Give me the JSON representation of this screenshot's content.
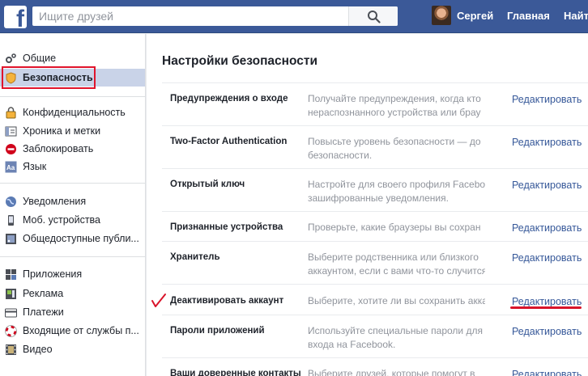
{
  "header": {
    "search_placeholder": "Ищите друзей",
    "user_name": "Сергей",
    "nav_home": "Главная",
    "nav_find": "Найти"
  },
  "sidebar": {
    "items": [
      {
        "label": "Общие",
        "icon": "gear-icon"
      },
      {
        "label": "Безопасность",
        "icon": "shield-icon",
        "active": true
      },
      {
        "label": "Конфиденциальность",
        "icon": "lock-icon"
      },
      {
        "label": "Хроника и метки",
        "icon": "timeline-icon"
      },
      {
        "label": "Заблокировать",
        "icon": "block-icon"
      },
      {
        "label": "Язык",
        "icon": "language-icon"
      },
      {
        "label": "Уведомления",
        "icon": "globe-icon"
      },
      {
        "label": "Моб. устройства",
        "icon": "mobile-icon"
      },
      {
        "label": "Общедоступные публи...",
        "icon": "rss-icon"
      },
      {
        "label": "Приложения",
        "icon": "apps-icon"
      },
      {
        "label": "Реклама",
        "icon": "ads-icon"
      },
      {
        "label": "Платежи",
        "icon": "card-icon"
      },
      {
        "label": "Входящие от службы п...",
        "icon": "lifebuoy-icon"
      },
      {
        "label": "Видео",
        "icon": "film-icon"
      }
    ]
  },
  "main": {
    "title": "Настройки безопасности",
    "edit_label": "Редактировать",
    "rows": [
      {
        "label": "Предупреждения о входе",
        "desc": [
          "Получайте предупреждения, когда кто",
          "нераспознанного устройства или брау"
        ]
      },
      {
        "label": "Two-Factor Authentication",
        "desc": [
          "Повысьте уровень безопасности — до",
          "безопасности."
        ]
      },
      {
        "label": "Открытый ключ",
        "desc": [
          "Настройте для своего профиля Facebo",
          "зашифрованные уведомления."
        ]
      },
      {
        "label": "Признанные устройства",
        "desc": [
          "Проверьте, какие браузеры вы сохран"
        ]
      },
      {
        "label": "Хранитель",
        "desc": [
          "Выберите родственника или близкого",
          "аккаунтом, если с вами что-то случится"
        ]
      },
      {
        "label": "Деактивировать аккаунт",
        "desc": [
          "Выберите, хотите ли вы сохранить акка"
        ]
      },
      {
        "label": "Пароли приложений",
        "desc": [
          "Используйте специальные пароли для",
          "входа на Facebook."
        ]
      },
      {
        "label": "Ваши доверенные контакты",
        "desc": [
          "Выберите друзей, которые помогут в"
        ]
      }
    ]
  },
  "colors": {
    "brand_blue": "#3b5998",
    "link_blue": "#365899",
    "annotation_red": "#e0142c",
    "active_bg": "#c9d3e8"
  }
}
